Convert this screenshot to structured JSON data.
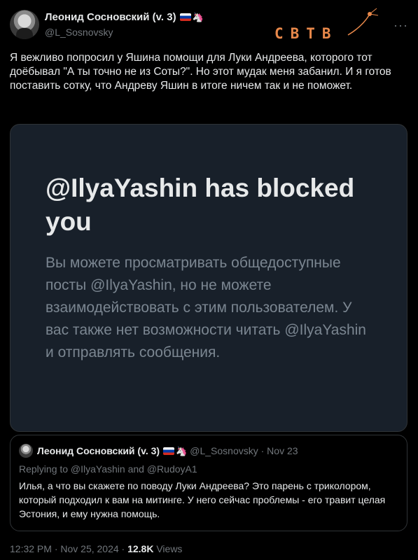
{
  "author": {
    "name": "Леонид Сосновский (v. 3)",
    "handle": "@L_Sosnovsky"
  },
  "watermark": {
    "text": "СВТВ"
  },
  "tweet": {
    "text": "Я вежливо попросил у Яшина помощи для Луки Андреева, которого тот доёбывал \"А ты точно не из Соты?\". Но этот мудак меня забанил. И я готов поставить сотку, что Андреву Яшин в итоге ничем так и не поможет."
  },
  "blocked_card": {
    "title": "@IlyaYashin has blocked you",
    "description": "Вы можете просматривать общедоступные посты @IlyaYashin, но не можете взаимодействовать с этим пользователем. У вас также нет возможности читать @IlyaYashin и отправлять сообщения."
  },
  "quoted_tweet": {
    "name": "Леонид Сосновский (v. 3)",
    "meta": "@L_Sosnovsky · Nov 23",
    "reply_to": "Replying to @IlyaYashin and @RudoyA1",
    "text": "Илья, а что вы скажете по поводу Луки Андреева? Это парень с триколором, который подходил к вам на митинге. У него сейчас проблемы - его травит целая Эстония, и ему нужна помощь."
  },
  "footer": {
    "timestamp": "12:32 PM · Nov 25, 2024 ·",
    "views_count": "12.8K",
    "views_label": "Views"
  },
  "icons": [
    "more-icon",
    "flag-ru-icon",
    "unicorn-icon"
  ],
  "colors": {
    "background": "#000000",
    "card": "#18202a",
    "muted": "#71767b",
    "logo": "#e8884a"
  }
}
